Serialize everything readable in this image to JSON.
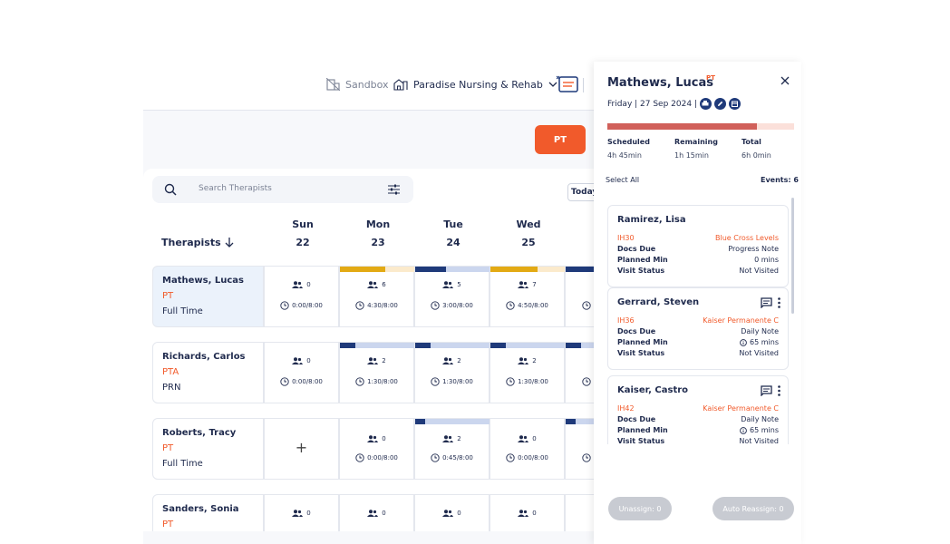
{
  "topbar": {
    "sandbox": "Sandbox",
    "facility": "Paradise Nursing & Rehab"
  },
  "filter": {
    "discipline": "PT",
    "today": "Today"
  },
  "search": {
    "placeholder": "Search Therapists"
  },
  "grid": {
    "therapists_header": "Therapists",
    "days": [
      {
        "name": "Sun",
        "date": "22"
      },
      {
        "name": "Mon",
        "date": "23"
      },
      {
        "name": "Tue",
        "date": "24"
      },
      {
        "name": "Wed",
        "date": "25"
      }
    ],
    "rows": [
      {
        "name": "Mathews, Lucas",
        "role": "PT",
        "type": "Full Time",
        "cells": [
          {
            "count": "0",
            "hours": "0:00/8:00"
          },
          {
            "count": "6",
            "hours": "4:30/8:00"
          },
          {
            "count": "5",
            "hours": "3:00/8:00"
          },
          {
            "count": "7",
            "hours": "4:50/8:00"
          }
        ]
      },
      {
        "name": "Richards, Carlos",
        "role": "PTA",
        "type": "PRN",
        "cells": [
          {
            "count": "0",
            "hours": "0:00/8:00"
          },
          {
            "count": "2",
            "hours": "1:30/8:00"
          },
          {
            "count": "2",
            "hours": "1:30/8:00"
          },
          {
            "count": "2",
            "hours": "1:30/8:00"
          }
        ]
      },
      {
        "name": "Roberts, Tracy",
        "role": "PT",
        "type": "Full Time",
        "cells": [
          {
            "count": "+",
            "hours": ""
          },
          {
            "count": "0",
            "hours": "0:00/8:00"
          },
          {
            "count": "2",
            "hours": "0:45/8:00"
          },
          {
            "count": "0",
            "hours": "0:00/8:00"
          }
        ]
      },
      {
        "name": "Sanders, Sonia",
        "role": "PT",
        "type": "",
        "cells": [
          {
            "count": "0",
            "hours": ""
          },
          {
            "count": "0",
            "hours": ""
          },
          {
            "count": "0",
            "hours": ""
          },
          {
            "count": "0",
            "hours": ""
          }
        ]
      }
    ]
  },
  "panel": {
    "name": "Mathews, Lucas",
    "role": "PT",
    "date": "Friday |  27 Sep 2024 |",
    "progress_fraction": 0.8,
    "stats": [
      {
        "label": "Scheduled",
        "value": "4h 45min"
      },
      {
        "label": "Remaining",
        "value": "1h 15min"
      },
      {
        "label": "Total",
        "value": "6h 0min"
      }
    ],
    "select_all": "Select All",
    "events_label": "Events: 6",
    "events": [
      {
        "name": "Ramirez, Lisa",
        "code": "IH30",
        "payer": "Blue Cross Levels",
        "docs_label": "Docs Due",
        "docs": "Progress Note",
        "planned_label": "Planned Min",
        "planned": "0 mins",
        "status_label": "Visit Status",
        "status": "Not Visited"
      },
      {
        "name": "Gerrard, Steven",
        "code": "IH36",
        "payer": "Kaiser Permanente C",
        "docs_label": "Docs Due",
        "docs": "Daily Note",
        "planned_label": "Planned Min",
        "planned": "65 mins",
        "status_label": "Visit Status",
        "status": "Not Visited"
      },
      {
        "name": "Kaiser, Castro",
        "code": "IH42",
        "payer": "Kaiser Permanente C",
        "docs_label": "Docs Due",
        "docs": "Daily Note",
        "planned_label": "Planned Min",
        "planned": "65 mins",
        "status_label": "Visit Status",
        "status": "Not Visited"
      }
    ],
    "unassign": "Unassign: 0",
    "auto_reassign": "Auto Reassign: 0"
  },
  "colors": {
    "accent": "#f15a2b",
    "navy": "#1f2a4d",
    "gold": "#e3aa14",
    "progress": "#d1605a"
  }
}
